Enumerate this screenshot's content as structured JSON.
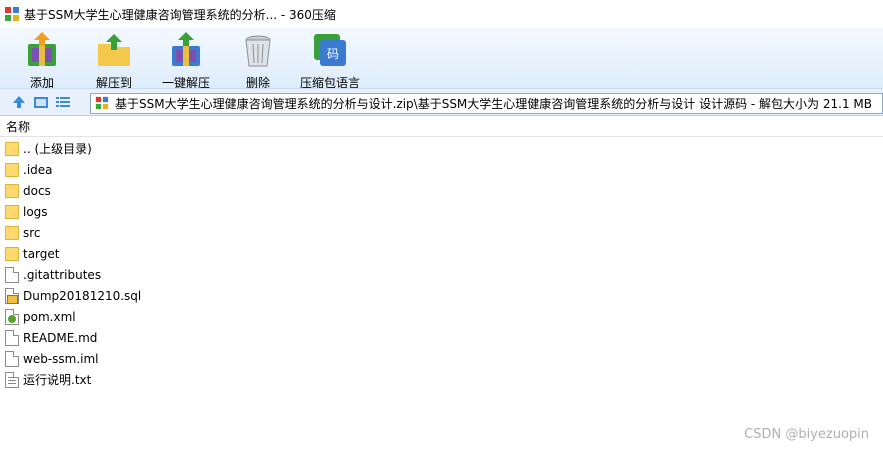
{
  "window": {
    "title": "基于SSM大学生心理健康咨询管理系统的分析... - 360压缩"
  },
  "toolbar": {
    "items": [
      {
        "label": "添加",
        "icon": "add-archive-icon"
      },
      {
        "label": "解压到",
        "icon": "extract-to-icon"
      },
      {
        "label": "一键解压",
        "icon": "one-click-extract-icon"
      },
      {
        "label": "删除",
        "icon": "delete-icon"
      },
      {
        "label": "压缩包语言",
        "icon": "archive-language-icon"
      }
    ]
  },
  "addressbar": {
    "path": "基于SSM大学生心理健康咨询管理系统的分析与设计.zip\\基于SSM大学生心理健康咨询管理系统的分析与设计 设计源码 - 解包大小为 21.1 MB"
  },
  "list": {
    "column_name": "名称",
    "items": [
      {
        "name": ".. (上级目录)",
        "type": "folder"
      },
      {
        "name": ".idea",
        "type": "folder"
      },
      {
        "name": "docs",
        "type": "folder"
      },
      {
        "name": "logs",
        "type": "folder"
      },
      {
        "name": "src",
        "type": "folder"
      },
      {
        "name": "target",
        "type": "folder"
      },
      {
        "name": ".gitattributes",
        "type": "file"
      },
      {
        "name": "Dump20181210.sql",
        "type": "sql"
      },
      {
        "name": "pom.xml",
        "type": "xml"
      },
      {
        "name": "README.md",
        "type": "file"
      },
      {
        "name": "web-ssm.iml",
        "type": "file"
      },
      {
        "name": "运行说明.txt",
        "type": "text"
      }
    ]
  },
  "watermark": "CSDN @biyezuopin",
  "colors": {
    "toolbar_bg": "#deecfb",
    "folder": "#ffd86e"
  }
}
